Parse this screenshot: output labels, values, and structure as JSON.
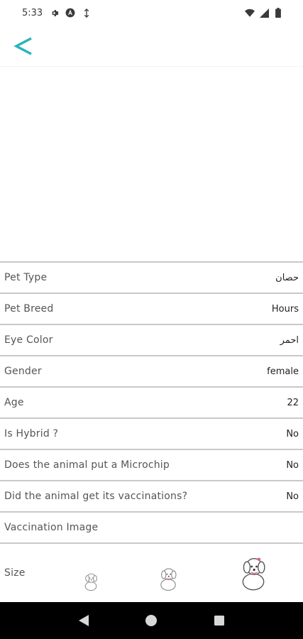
{
  "status_bar": {
    "time": "5:33",
    "icons": [
      "gear-icon",
      "a-badge-icon",
      "data-sync-icon",
      "wifi-icon",
      "signal-icon",
      "battery-icon"
    ]
  },
  "toolbar": {
    "back_icon": "chevron-left-icon",
    "accent_color": "#2bb3c0"
  },
  "details": [
    {
      "label": "Pet Type",
      "value": "حصان"
    },
    {
      "label": "Pet Breed",
      "value": "Hours"
    },
    {
      "label": "Eye Color",
      "value": "احمر"
    },
    {
      "label": "Gender",
      "value": "female"
    },
    {
      "label": "Age",
      "value": "22"
    },
    {
      "label": "Is Hybrid ?",
      "value": "No"
    },
    {
      "label": "Does the animal put a Microchip",
      "value": "No"
    },
    {
      "label": "Did the animal get its vaccinations?",
      "value": "No"
    },
    {
      "label": "Vaccination Image",
      "value": ""
    }
  ],
  "size": {
    "label": "Size",
    "options": [
      "small-dog-icon",
      "medium-dog-icon",
      "large-dog-icon"
    ]
  },
  "nav": {
    "buttons": [
      "back-triangle-icon",
      "home-circle-icon",
      "recents-square-icon"
    ]
  }
}
